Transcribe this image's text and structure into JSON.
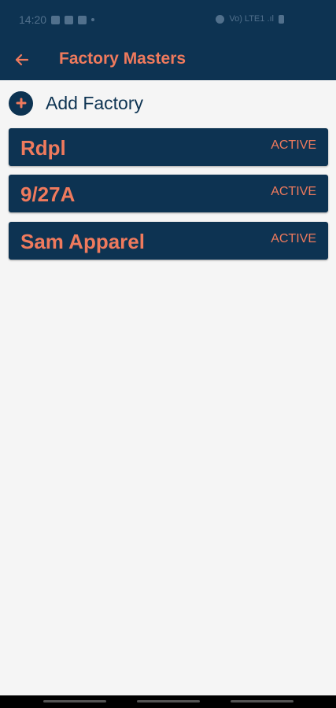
{
  "status_bar": {
    "time": "14:20",
    "right_text": "Vo) LTE1 .ıl"
  },
  "app_bar": {
    "title": "Factory Masters",
    "back_icon": "arrow-left-icon"
  },
  "add_action": {
    "label": "Add Factory",
    "icon": "plus-circle-icon"
  },
  "factories": [
    {
      "name": "Rdpl",
      "status": "ACTIVE"
    },
    {
      "name": "9/27A",
      "status": "ACTIVE"
    },
    {
      "name": "Sam Apparel",
      "status": "ACTIVE"
    }
  ],
  "colors": {
    "primary": "#0d3352",
    "accent": "#ef7a5d",
    "background": "#f5f5f5"
  }
}
